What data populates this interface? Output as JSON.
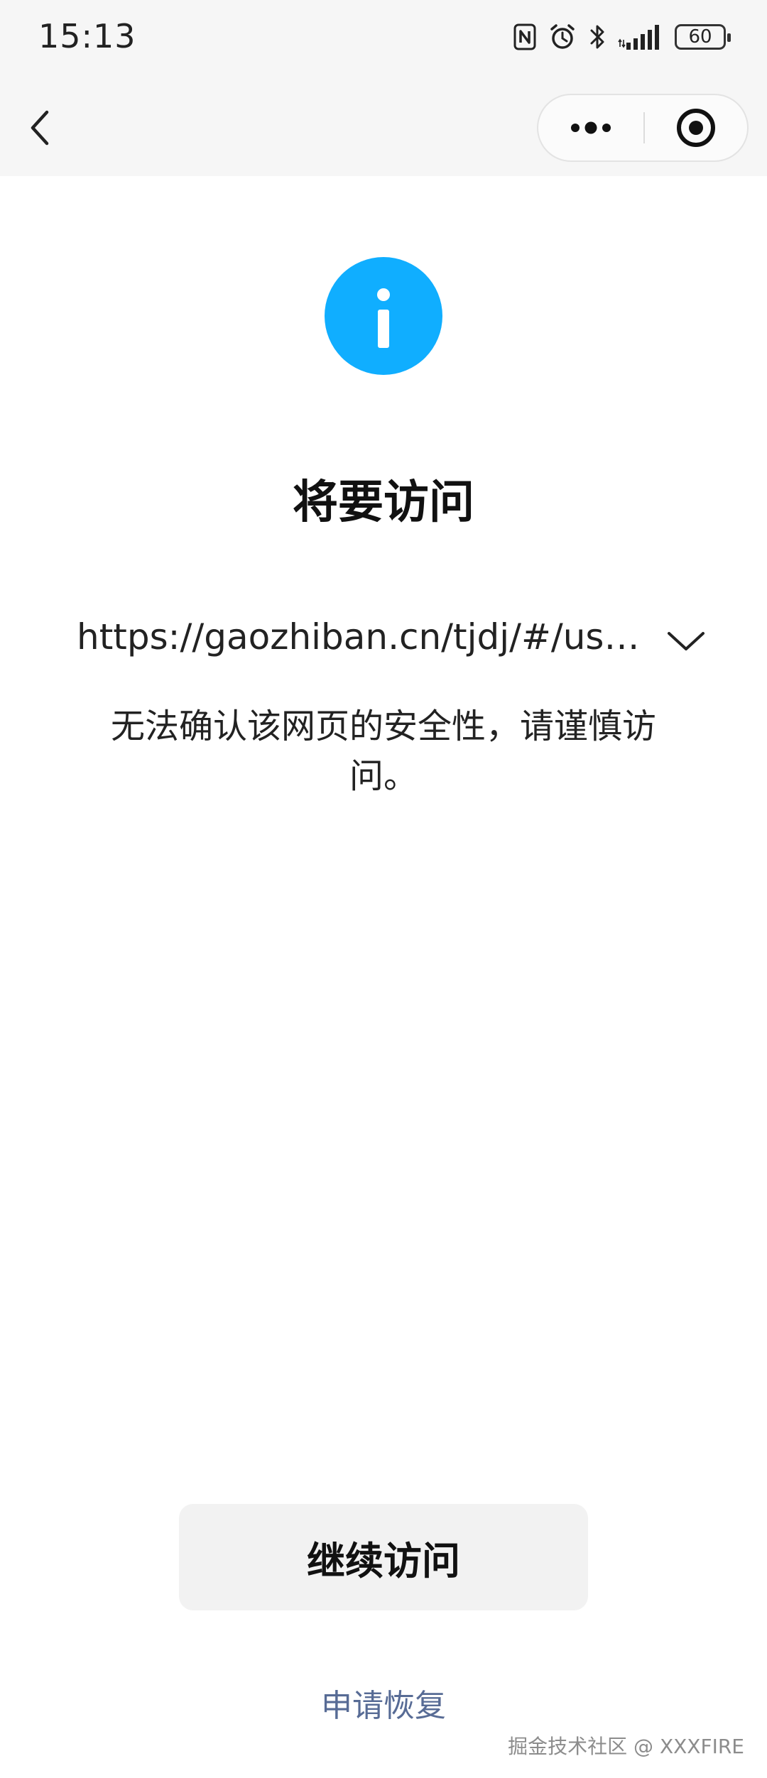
{
  "status_bar": {
    "time": "15:13",
    "battery": "60",
    "icons": [
      "nfc-icon",
      "alarm-icon",
      "bluetooth-icon",
      "signal-icon",
      "battery-icon"
    ]
  },
  "nav": {
    "back_icon": "chevron-left-icon",
    "more_icon": "more-dots-icon",
    "close_icon": "target-circle-icon"
  },
  "content": {
    "icon": "info-icon",
    "icon_color": "#10aeff",
    "title": "将要访问",
    "url": "https://gaozhiban.cn/tjdj/#/user...",
    "expand_icon": "chevron-down-icon",
    "warning": "无法确认该网页的安全性，请谨慎访问。"
  },
  "actions": {
    "continue_label": "继续访问",
    "appeal_label": "申请恢复",
    "link_color": "#576b95"
  },
  "watermark": "掘金技术社区 @ XXXFIRE"
}
